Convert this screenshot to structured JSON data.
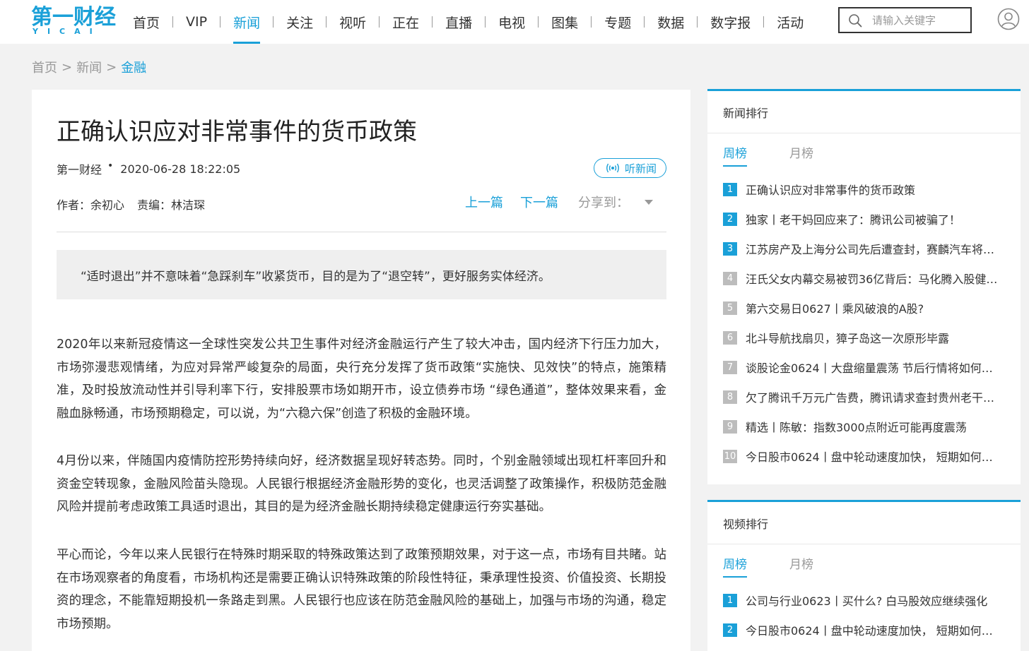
{
  "header": {
    "logo_text": "第一财经",
    "logo_sub": "YICAI",
    "nav": [
      {
        "label": "首页",
        "active": false
      },
      {
        "label": "VIP",
        "active": false
      },
      {
        "label": "新闻",
        "active": true
      },
      {
        "label": "关注",
        "active": false
      },
      {
        "label": "视听",
        "active": false
      },
      {
        "label": "正在",
        "active": false
      },
      {
        "label": "直播",
        "active": false
      },
      {
        "label": "电视",
        "active": false
      },
      {
        "label": "图集",
        "active": false
      },
      {
        "label": "专题",
        "active": false
      },
      {
        "label": "数据",
        "active": false
      },
      {
        "label": "数字报",
        "active": false
      },
      {
        "label": "活动",
        "active": false
      }
    ],
    "search_placeholder": "请输入关键字"
  },
  "breadcrumb": {
    "items": [
      "首页",
      "新闻"
    ],
    "current": "金融",
    "separator": ">"
  },
  "article": {
    "title": "正确认识应对非常事件的货币政策",
    "source": "第一财经",
    "dot": "•",
    "datetime": "2020-06-28 18:22:05",
    "listen_label": "听新闻",
    "author": "作者：余初心",
    "editor": "责编：林洁琛",
    "prev_label": "上一篇",
    "next_label": "下一篇",
    "share_label": "分享到：",
    "summary": "“适时退出”并不意味着“急踩刹车”收紧货币，目的是为了“退空转”，更好服务实体经济。",
    "paragraphs": [
      "2020年以来新冠疫情这一全球性突发公共卫生事件对经济金融运行产生了较大冲击，国内经济下行压力加大，市场弥漫悲观情绪，为应对异常严峻复杂的局面，央行充分发挥了货币政策“实施快、见效快”的特点，施策精准，及时投放流动性并引导利率下行，安排股票市场如期开市，设立债券市场 “绿色通道”，整体效果来看，金融血脉畅通，市场预期稳定，可以说，为“六稳六保”创造了积极的金融环境。",
      "4月份以来，伴随国内疫情防控形势持续向好，经济数据呈现好转态势。同时，个别金融领域出现杠杆率回升和资金空转现象，金融风险苗头隐现。人民银行根据经济金融形势的变化，也灵活调整了政策操作，积极防范金融风险并提前考虑政策工具适时退出，其目的是为经济金融长期持续稳定健康运行夯实基础。",
      "平心而论，今年以来人民银行在特殊时期采取的特殊政策达到了政策预期效果，对于这一点，市场有目共睹。站在市场观察者的角度看，市场机构还是需要正确认识特殊政策的阶段性特征，秉承理性投资、价值投资、长期投资的理念，不能靠短期投机一条路走到黑。人民银行也应该在防范金融风险的基础上，加强与市场的沟通，稳定市场预期。"
    ]
  },
  "news_rank": {
    "title": "新闻排行",
    "tabs": [
      {
        "label": "周榜",
        "active": true
      },
      {
        "label": "月榜",
        "active": false
      }
    ],
    "items": [
      {
        "num": "1",
        "text": "正确认识应对非常事件的货币政策"
      },
      {
        "num": "2",
        "text": "独家丨老干妈回应来了：腾讯公司被骗了！"
      },
      {
        "num": "3",
        "text": "江苏房产及上海分公司先后遭查封，赛麟汽车将…"
      },
      {
        "num": "4",
        "text": "汪氏父女内幕交易被罚36亿背后：马化腾入股健…"
      },
      {
        "num": "5",
        "text": "第六交易日0627丨乘风破浪的A股?"
      },
      {
        "num": "6",
        "text": "北斗导航找扇贝，獐子岛这一次原形毕露"
      },
      {
        "num": "7",
        "text": "谈股论金0624丨大盘缩量震荡 节后行情将如何…"
      },
      {
        "num": "8",
        "text": "欠了腾讯千万元广告费，腾讯请求查封贵州老干…"
      },
      {
        "num": "9",
        "text": "精选丨陈敏：指数3000点附近可能再度震荡"
      },
      {
        "num": "10",
        "text": "今日股市0624丨盘中轮动速度加快， 短期如何…"
      }
    ]
  },
  "video_rank": {
    "title": "视频排行",
    "tabs": [
      {
        "label": "周榜",
        "active": true
      },
      {
        "label": "月榜",
        "active": false
      }
    ],
    "items": [
      {
        "num": "1",
        "text": "公司与行业0623丨买什么? 白马股效应继续强化"
      },
      {
        "num": "2",
        "text": "今日股市0624丨盘中轮动速度加快， 短期如何…"
      }
    ]
  },
  "colors": {
    "accent": "#1aa0d8",
    "rank_other": "#bcbcbc",
    "page_bg": "#f2f2f2"
  },
  "icons": [
    "search-icon",
    "user-icon",
    "sound-wave-icon",
    "chevron-down-icon"
  ]
}
